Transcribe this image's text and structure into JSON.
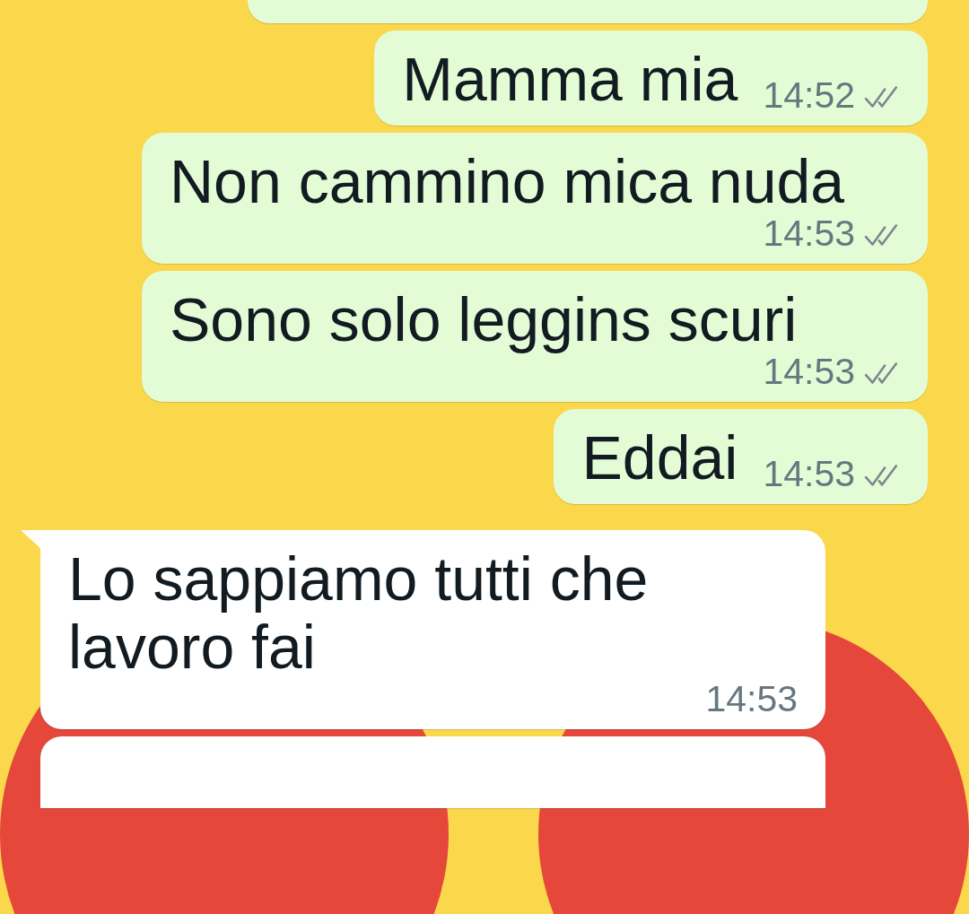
{
  "messages": [
    {
      "kind": "partial",
      "outgoing": true
    },
    {
      "kind": "text",
      "outgoing": true,
      "text": "Mamma mia",
      "time": "14:52",
      "read": false
    },
    {
      "kind": "text",
      "outgoing": true,
      "text": "Non cammino mica nuda",
      "time": "14:53",
      "read": false
    },
    {
      "kind": "text",
      "outgoing": true,
      "text": "Sono solo leggins scuri",
      "time": "14:53",
      "read": false
    },
    {
      "kind": "text",
      "outgoing": true,
      "text": "Eddai",
      "time": "14:53",
      "read": false
    },
    {
      "kind": "text",
      "outgoing": false,
      "text": "Lo sappiamo tutti che lavoro fai",
      "time": "14:53",
      "tail": true
    },
    {
      "kind": "partial",
      "outgoing": false
    }
  ]
}
